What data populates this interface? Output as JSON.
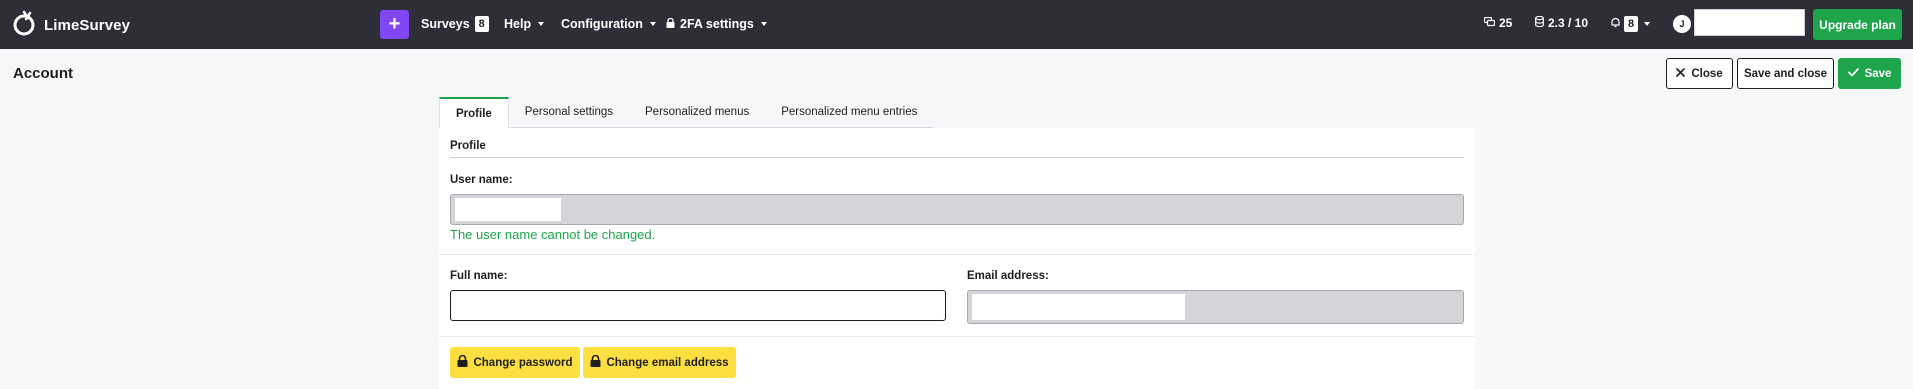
{
  "navbar": {
    "brand": "LimeSurvey",
    "add_label": "+",
    "menus": [
      {
        "label": "Surveys",
        "badge": "8"
      },
      {
        "label": "Help"
      },
      {
        "label": "Configuration"
      },
      {
        "label": "2FA settings"
      }
    ],
    "stats": {
      "responses": "25",
      "storage": "2.3 / 10",
      "notifications": "8"
    },
    "avatar_initial": "J",
    "upgrade_label": "Upgrade plan"
  },
  "page": {
    "title": "Account"
  },
  "header_buttons": {
    "close": "Close",
    "save_and_close": "Save and close",
    "save": "Save"
  },
  "tabs": [
    {
      "label": "Profile",
      "active": true
    },
    {
      "label": "Personal settings"
    },
    {
      "label": "Personalized menus"
    },
    {
      "label": "Personalized menu entries"
    }
  ],
  "profile": {
    "section_title": "Profile",
    "username_label": "User name:",
    "username_hint": "The user name cannot be changed.",
    "fullname_label": "Full name:",
    "fullname_value": "",
    "email_label": "Email address:",
    "change_password": "Change password",
    "change_email": "Change email address"
  },
  "colors": {
    "navbar_bg": "#2d2e38",
    "accent_purple": "#8146f6",
    "accent_green": "#1ea54b",
    "button_yellow": "#fddf41"
  }
}
